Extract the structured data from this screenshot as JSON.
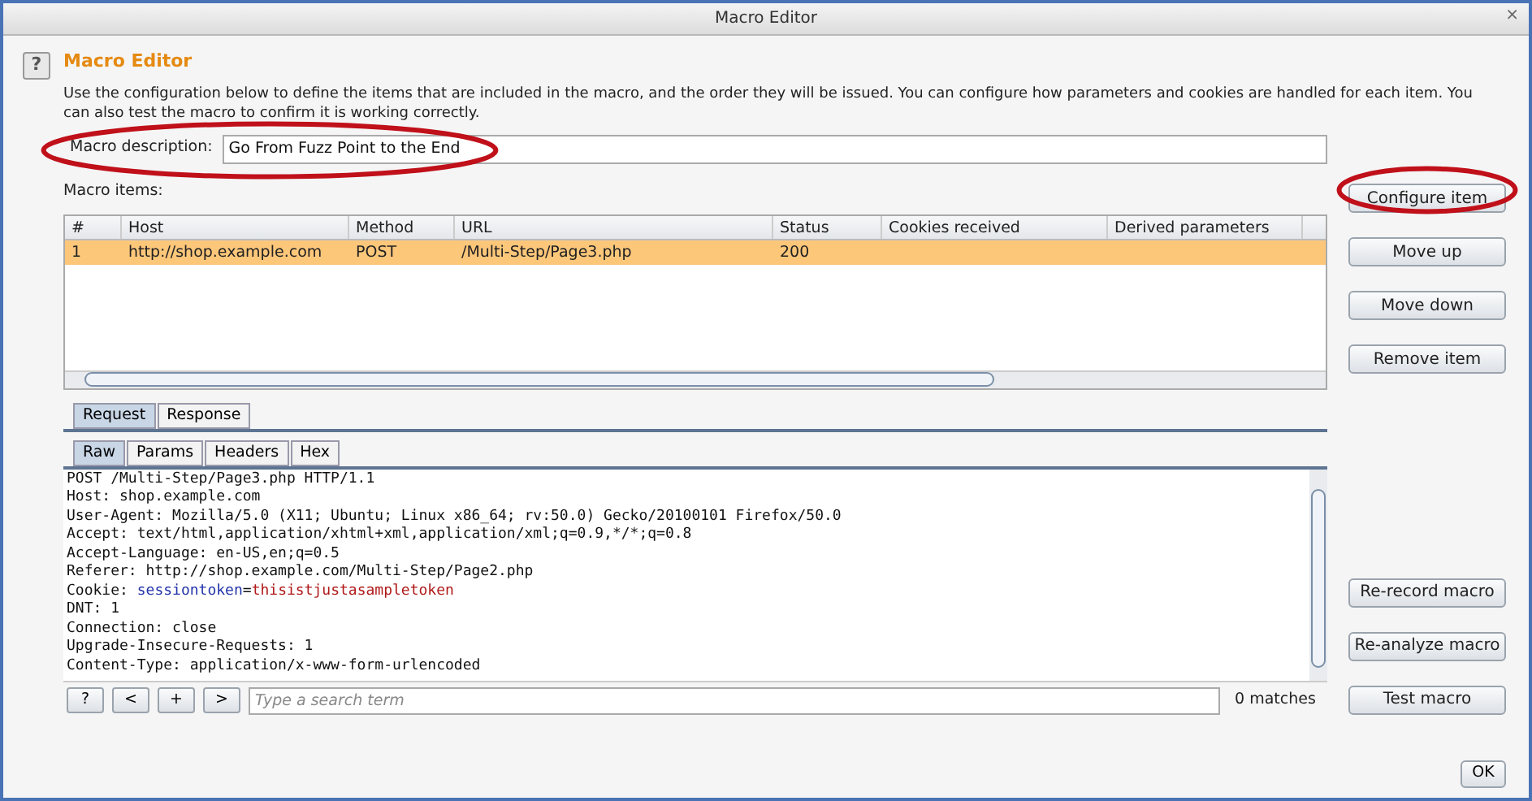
{
  "window": {
    "title": "Macro Editor",
    "close": "×"
  },
  "header": {
    "help": "?",
    "title": "Macro Editor",
    "description": "Use the configuration below to define the items that are included in the macro, and the order they will be issued. You can configure how parameters and cookies are handled for each item. You can also test the macro to confirm it is working correctly."
  },
  "description_field": {
    "label": "Macro description:",
    "value": "Go From Fuzz Point to the End"
  },
  "items_label": "Macro items:",
  "table": {
    "columns": [
      "#",
      "Host",
      "Method",
      "URL",
      "Status",
      "Cookies received",
      "Derived parameters"
    ],
    "rows": [
      {
        "selected": true,
        "cells": [
          "1",
          "http://shop.example.com",
          "POST",
          "/Multi-Step/Page3.php",
          "200",
          "",
          ""
        ]
      }
    ]
  },
  "item_buttons": [
    {
      "label": "Configure item",
      "highlighted": true
    },
    {
      "label": "Move up",
      "highlighted": false
    },
    {
      "label": "Move down",
      "highlighted": false
    },
    {
      "label": "Remove item",
      "highlighted": false
    }
  ],
  "tabs": [
    {
      "label": "Request",
      "selected": true
    },
    {
      "label": "Response",
      "selected": false
    }
  ],
  "subtabs": [
    {
      "label": "Raw",
      "selected": true
    },
    {
      "label": "Params",
      "selected": false
    },
    {
      "label": "Headers",
      "selected": false
    },
    {
      "label": "Hex",
      "selected": false
    }
  ],
  "request_lines": [
    [
      {
        "kind": "plain",
        "text": "POST /Multi-Step/Page3.php HTTP/1.1"
      }
    ],
    [
      {
        "kind": "plain",
        "text": "Host: shop.example.com"
      }
    ],
    [
      {
        "kind": "plain",
        "text": "User-Agent: Mozilla/5.0 (X11; Ubuntu; Linux x86_64; rv:50.0) Gecko/20100101 Firefox/50.0"
      }
    ],
    [
      {
        "kind": "plain",
        "text": "Accept: text/html,application/xhtml+xml,application/xml;q=0.9,*/*;q=0.8"
      }
    ],
    [
      {
        "kind": "plain",
        "text": "Accept-Language: en-US,en;q=0.5"
      }
    ],
    [
      {
        "kind": "plain",
        "text": "Referer: http://shop.example.com/Multi-Step/Page2.php"
      }
    ],
    [
      {
        "kind": "plain",
        "text": "Cookie: "
      },
      {
        "kind": "name",
        "text": "sessiontoken"
      },
      {
        "kind": "plain",
        "text": "="
      },
      {
        "kind": "value",
        "text": "thisistjustasampletoken"
      }
    ],
    [
      {
        "kind": "plain",
        "text": "DNT: 1"
      }
    ],
    [
      {
        "kind": "plain",
        "text": "Connection: close"
      }
    ],
    [
      {
        "kind": "plain",
        "text": "Upgrade-Insecure-Requests: 1"
      }
    ],
    [
      {
        "kind": "plain",
        "text": "Content-Type: application/x-www-form-urlencoded"
      }
    ]
  ],
  "search": {
    "buttons": [
      "?",
      "<",
      "+",
      ">"
    ],
    "placeholder": "Type a search term",
    "matches": "0 matches"
  },
  "macro_buttons": [
    {
      "label": "Re-record macro",
      "highlighted": false
    },
    {
      "label": "Re-analyze macro",
      "highlighted": false
    },
    {
      "label": "Test macro",
      "highlighted": false
    }
  ],
  "ok": "OK"
}
